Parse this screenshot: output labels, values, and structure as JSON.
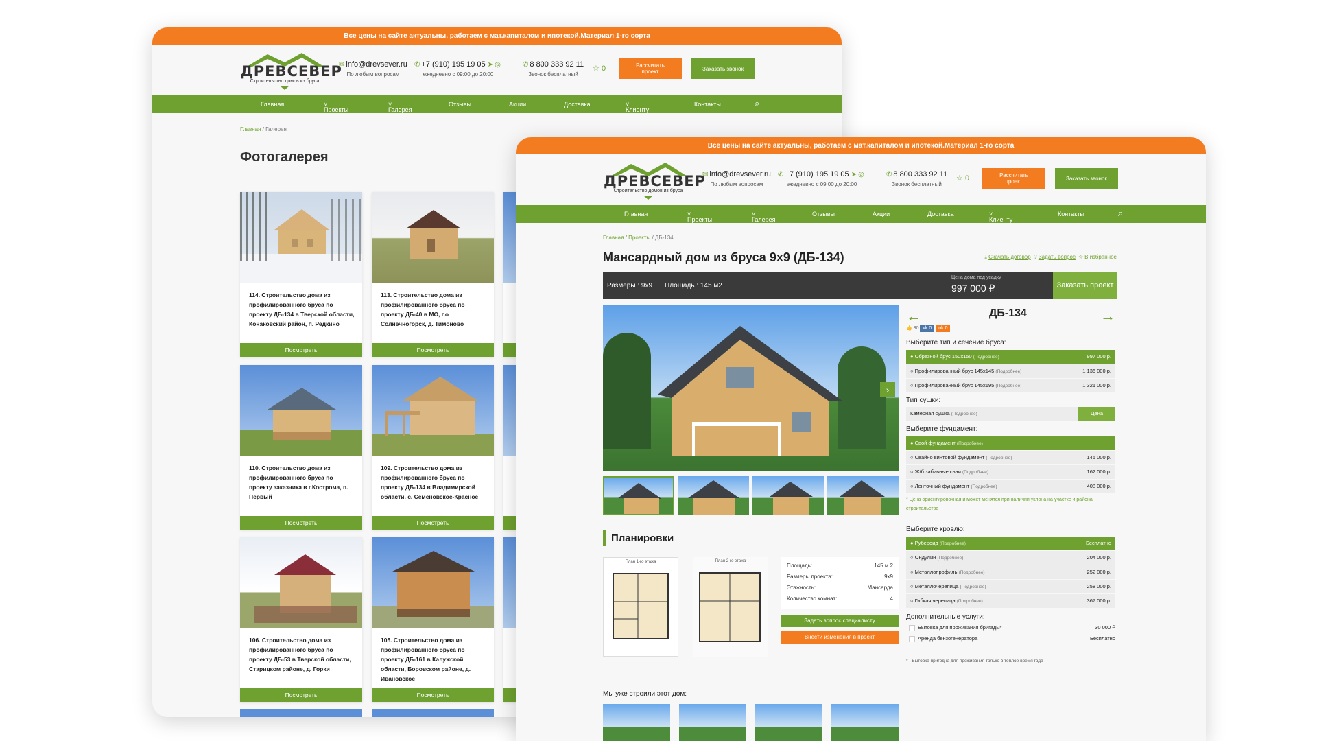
{
  "banner": "Все цены на сайте актуальны, работаем с мат.капиталом и ипотекой.Материал 1-го сорта",
  "logo": {
    "name": "ДРЕВСЕВЕР",
    "tagline": "Строительство домов из бруса"
  },
  "contacts": {
    "email": "info@drevsever.ru",
    "email_sub": "По любым вопросам",
    "phone1": "+7 (910) 195 19 05",
    "phone1_sub": "ежедневно с 09:00 до 20:00",
    "phone2": "8 800 333 92 11",
    "phone2_sub": "Звонок бесплатный"
  },
  "favorites_count": "0",
  "buttons": {
    "calc": "Рассчитать проект",
    "call": "Заказать звонок"
  },
  "nav": [
    "Главная",
    "Проекты",
    "Галерея",
    "Отзывы",
    "Акции",
    "Доставка",
    "Клиенту",
    "Контакты"
  ],
  "gallery_page": {
    "crumbs": [
      "Главная",
      "Галерея"
    ],
    "title": "Фотогалерея",
    "view_label": "Посмотреть",
    "cards": [
      {
        "caption": "114. Строительство дома из профилированного бруса по проекту ДБ-134 в Тверской области, Конаковский район, п. Редкино"
      },
      {
        "caption": "113. Строительство дома из профилированного бруса по проекту ДБ-40 в МО, г.о Солнечногорск, д. Тимоново"
      },
      {
        "caption": "110. Строительство дома из профилированного бруса по проекту заказчика в г.Кострома, п. Первый"
      },
      {
        "caption": "109. Строительство дома из профилированного бруса по проекту ДБ-134 в Владимирской области, с. Семеновское-Красное"
      },
      {
        "caption": "106. Строительство дома из профилированного бруса по проекту ДБ-53 в Тверской области, Старицком районе, д. Горки"
      },
      {
        "caption": "105. Строительство дома из профилированного бруса по проекту ДБ-161 в Калужской области, Боровском районе, д. Ивановское"
      }
    ]
  },
  "product_page": {
    "crumbs": [
      "Главная",
      "Проекты",
      "ДБ-134"
    ],
    "title": "Мансардный дом из бруса 9х9 (ДБ-134)",
    "links": {
      "contract": "Скачать договор",
      "ask": "Задать вопрос",
      "fav": "В избранное"
    },
    "size": "Размеры : 9x9",
    "area": "Площадь : 145 м2",
    "price_label": "Цена дома под усадку",
    "price": "997 000 ₽",
    "order": "Заказать проект",
    "code": "ДБ-134",
    "social": {
      "likes": "30",
      "vk": "0",
      "ok": "0"
    },
    "beam_label": "Выберите тип и сечение бруса:",
    "beam_options": [
      {
        "name": "Обрезной брус 150х150",
        "price": "997 000 р."
      },
      {
        "name": "Профилированный брус 145х145",
        "price": "1 136 000 р."
      },
      {
        "name": "Профилированный брус 145х195",
        "price": "1 321 000 р."
      }
    ],
    "more": "(Подробнее)",
    "dry_label": "Тип сушки:",
    "dry_option": "Камерная сушка",
    "dry_price": "Цена",
    "found_label": "Выберите фундамент:",
    "found_options": [
      {
        "name": "Свой фундамент",
        "price": ""
      },
      {
        "name": "Свайно винтовой фундамент",
        "price": "145 000 р."
      },
      {
        "name": "Ж/б забивные сваи",
        "price": "162 000 р."
      },
      {
        "name": "Ленточный фундамент",
        "price": "408 000 р."
      }
    ],
    "found_note": "* Цена ориентировочная и может менятся при наличии уклона на участке и района строительства",
    "roof_label": "Выберите кровлю:",
    "roof_options": [
      {
        "name": "Рубероид",
        "price": "Бесплатно"
      },
      {
        "name": "Ондулин",
        "price": "204 000 р."
      },
      {
        "name": "Металлопрофиль",
        "price": "252 000 р."
      },
      {
        "name": "Металлочерепица",
        "price": "258 000 р."
      },
      {
        "name": "Гибкая черепица",
        "price": "367 000 р."
      }
    ],
    "extra_label": "Дополнительные услуги:",
    "extras": [
      {
        "name": "Бытовка для проживания бригады*",
        "price": "30 000 ₽"
      },
      {
        "name": "Аренда бензогенератора",
        "price": "Бесплатно"
      }
    ],
    "extra_note": "* - Бытовка пригодна для проживания только в теплое время года",
    "plans_title": "Планировки",
    "plan1": "План 1-го этажа",
    "plan2": "План 2-го этажа",
    "specs": [
      {
        "k": "Площадь:",
        "v": "145 м 2"
      },
      {
        "k": "Размеры проекта:",
        "v": "9x9"
      },
      {
        "k": "Этажность:",
        "v": "Мансарда"
      },
      {
        "k": "Количество комнат:",
        "v": "4"
      }
    ],
    "ask_btn": "Задать вопрос специалисту",
    "change_btn": "Внести изменения в проект",
    "built_title": "Мы уже строили этот дом:"
  },
  "colors": {
    "orange": "#f47c20",
    "green": "#6ea12f",
    "dark": "#3a3a3a"
  }
}
